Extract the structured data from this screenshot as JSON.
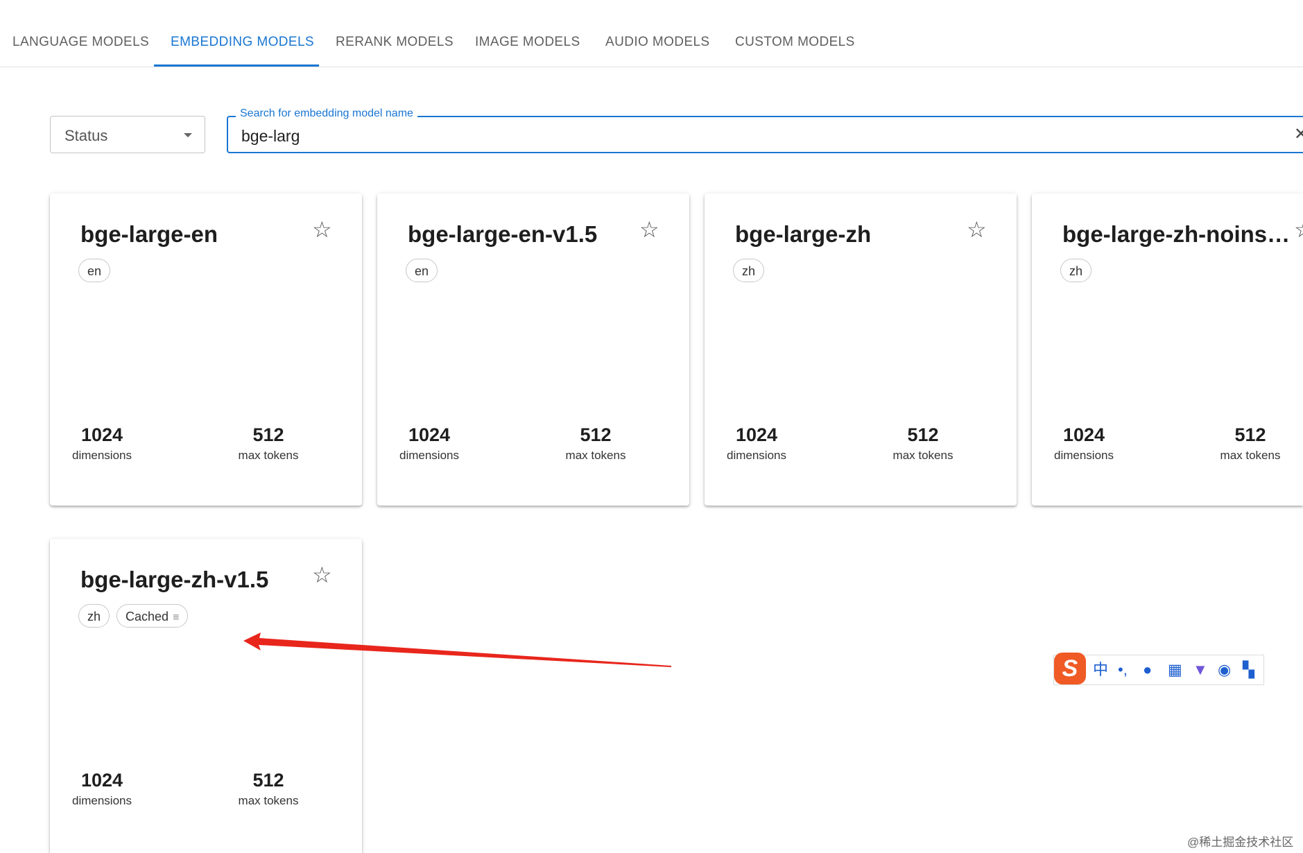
{
  "tabs": [
    {
      "label": "LANGUAGE MODELS"
    },
    {
      "label": "EMBEDDING MODELS"
    },
    {
      "label": "RERANK MODELS"
    },
    {
      "label": "IMAGE MODELS"
    },
    {
      "label": "AUDIO MODELS"
    },
    {
      "label": "CUSTOM MODELS"
    }
  ],
  "filters": {
    "status_label": "Status",
    "search_label": "Search for embedding model name",
    "search_value": "bge-larg"
  },
  "cards": [
    {
      "title": "bge-large-en",
      "chips": [
        "en"
      ],
      "dimensions": "1024",
      "dimensions_label": "dimensions",
      "max_tokens": "512",
      "max_tokens_label": "max tokens"
    },
    {
      "title": "bge-large-en-v1.5",
      "chips": [
        "en"
      ],
      "dimensions": "1024",
      "dimensions_label": "dimensions",
      "max_tokens": "512",
      "max_tokens_label": "max tokens"
    },
    {
      "title": "bge-large-zh",
      "chips": [
        "zh"
      ],
      "dimensions": "1024",
      "dimensions_label": "dimensions",
      "max_tokens": "512",
      "max_tokens_label": "max tokens"
    },
    {
      "title": "bge-large-zh-noinstruct",
      "chips": [
        "zh"
      ],
      "dimensions": "1024",
      "dimensions_label": "dimensions",
      "max_tokens": "512",
      "max_tokens_label": "max tokens"
    },
    {
      "title": "bge-large-zh-v1.5",
      "chips": [
        "zh"
      ],
      "cached_label": "Cached",
      "dimensions": "1024",
      "dimensions_label": "dimensions",
      "max_tokens": "512",
      "max_tokens_label": "max tokens"
    }
  ],
  "ime": {
    "items": [
      "中",
      "•,"
    ]
  },
  "watermark": "@稀土掘金技术社区",
  "colors": {
    "accent": "#1976d2",
    "annotation_arrow": "#e8261c",
    "ime_logo": "#f05a24"
  }
}
